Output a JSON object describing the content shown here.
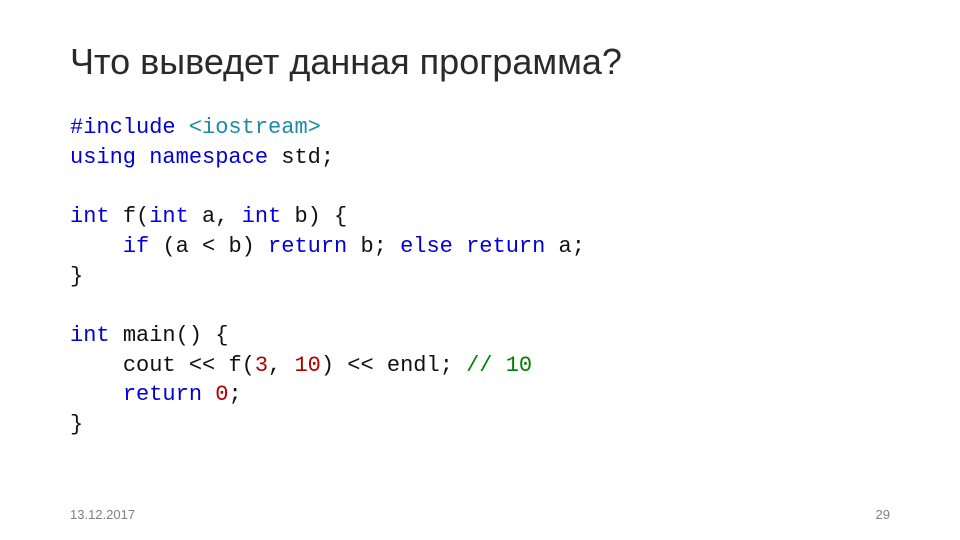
{
  "title": "Что выведет данная программа?",
  "code": {
    "t": {
      "include": "#include",
      "using": "using",
      "namespace": "namespace",
      "int": "int",
      "if": "if",
      "else": "else",
      "return": "return",
      "iostream": " <iostream>",
      "std": "std",
      "cout": "cout",
      "endl": "endl",
      "f": "f",
      "main": "main",
      "a": "a",
      "b": "b",
      "sig_open": "(",
      "sig_close": ")",
      "brace_open": " {",
      "brace_close": "}",
      "comma": ", ",
      "semi": ";",
      "lt": " < ",
      "ins": " << ",
      "sp": " ",
      "n3": "3",
      "n10": "10",
      "n0": "0",
      "cmt_body": " 10",
      "cmt_prefix": "//"
    }
  },
  "footer": {
    "date": "13.12.2017",
    "page": "29"
  }
}
